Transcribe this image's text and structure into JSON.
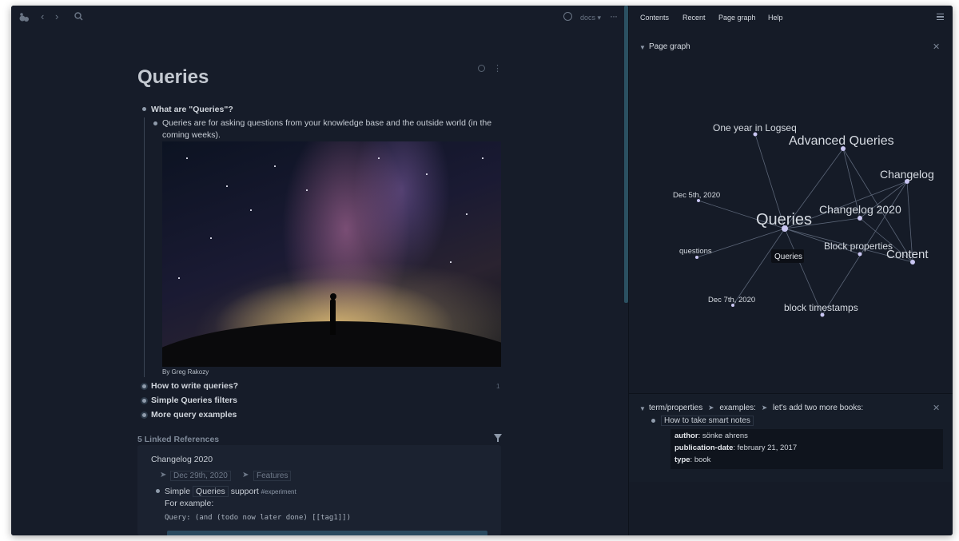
{
  "topbar": {
    "graph_name": "docs ▾",
    "more_label": "···"
  },
  "page": {
    "title": "Queries",
    "blocks": [
      {
        "label": "What are \"Queries\"?"
      },
      {
        "label": "Queries are for asking questions from your knowledge base and the outside world (in the"
      },
      {
        "label": "coming weeks)."
      },
      {
        "label": "By Greg Rakozy"
      },
      {
        "label": "How to write queries?",
        "count": "1"
      },
      {
        "label": "Simple Queries filters"
      },
      {
        "label": "More query examples"
      }
    ],
    "linked_refs_title": "5 Linked References",
    "ref": {
      "page": "Changelog 2020",
      "crumb_sep": "➤",
      "crumb_date": "Dec 29th, 2020",
      "crumb_features": "Features",
      "line_start": "Simple",
      "line_link": "Queries",
      "line_end": "support",
      "tag": "#experiment",
      "for_example": "For example:",
      "code": "Query: (and (todo now later done) [[tag1]])"
    }
  },
  "sidebar": {
    "tabs": [
      "Contents",
      "Recent",
      "Page graph",
      "Help"
    ],
    "graph_section_title": "Page graph",
    "graph_nodes": [
      {
        "label": "One year in Logseq",
        "size": "small"
      },
      {
        "label": "Advanced Queries",
        "size": "medium"
      },
      {
        "label": "Changelog",
        "size": "medium"
      },
      {
        "label": "Dec 5th, 2020",
        "size": "tiny"
      },
      {
        "label": "Queries",
        "size": "large"
      },
      {
        "label": "Changelog 2020",
        "size": "medium"
      },
      {
        "label": "questions",
        "size": "tiny"
      },
      {
        "label": "Block properties",
        "size": "small"
      },
      {
        "label": "Content",
        "size": "medium"
      },
      {
        "label": "Dec 7th, 2020",
        "size": "tiny"
      },
      {
        "label": "block timestamps",
        "size": "small"
      }
    ],
    "graph_tooltip": "Queries",
    "block_crumbs": [
      "term/properties",
      "examples:",
      "let's add two more books:"
    ],
    "block_crumb_sep": "➤",
    "sub_item": "How to take smart notes",
    "properties": [
      {
        "key": "author",
        "value": "sönke ahrens"
      },
      {
        "key": "publication-date",
        "value": "february 21, 2017"
      },
      {
        "key": "type",
        "value": "book"
      }
    ]
  },
  "colors": {
    "app_bg": "#161c29",
    "sidebar_bg": "#151b27",
    "accent": "#2b5061",
    "graph_node": "#c9c6f2",
    "graph_edge": "#5b6577"
  }
}
